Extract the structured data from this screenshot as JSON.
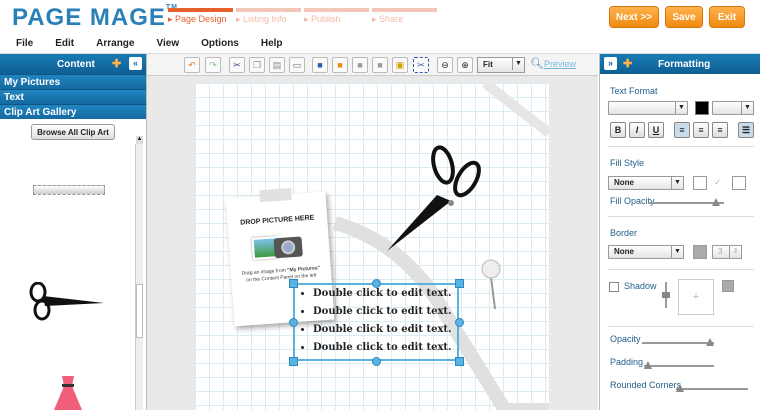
{
  "app": {
    "logo": "PAGE MAGE",
    "tm": "TM"
  },
  "steps": [
    {
      "label": "Page Design",
      "active": true
    },
    {
      "label": "Listing Info",
      "active": false
    },
    {
      "label": "Publish",
      "active": false
    },
    {
      "label": "Share",
      "active": false
    }
  ],
  "header_buttons": {
    "next": "Next >>",
    "save": "Save",
    "exit": "Exit"
  },
  "menu": [
    "File",
    "Edit",
    "Arrange",
    "View",
    "Options",
    "Help"
  ],
  "left_panel": {
    "title": "Content",
    "sections": [
      "My Pictures",
      "Text",
      "Clip Art Gallery"
    ],
    "browse": "Browse All Clip Art"
  },
  "toolbar": {
    "zoom_value": "Fit",
    "preview": "Preview"
  },
  "canvas": {
    "drop_title": "DROP PICTURE HERE",
    "drop_hint_1": "Drag an image from",
    "drop_hint_bold": "\"My Pictures\"",
    "drop_hint_2": "on the Content Panel on the left",
    "bullets": [
      "Double click to edit text.",
      "Double click to edit text.",
      "Double click to edit text.",
      "Double click to edit text."
    ]
  },
  "right_panel": {
    "title": "Formatting",
    "text_format": "Text Format",
    "fill_style": "Fill Style",
    "fill_value": "None",
    "fill_opacity": "Fill Opacity",
    "border": "Border",
    "border_value": "None",
    "border_width": "3",
    "shadow": "Shadow",
    "opacity": "Opacity",
    "padding": "Padding",
    "rounded": "Rounded Corners",
    "bold": "B",
    "italic": "I",
    "underline": "U"
  },
  "sliders": {
    "fill_opacity": 0.9,
    "opacity": 0.95,
    "padding": 0.05,
    "rounded": 0.05
  },
  "colors": {
    "brand": "#2b80b8",
    "accent": "#f08a10",
    "panel": "#1a7bb5"
  }
}
